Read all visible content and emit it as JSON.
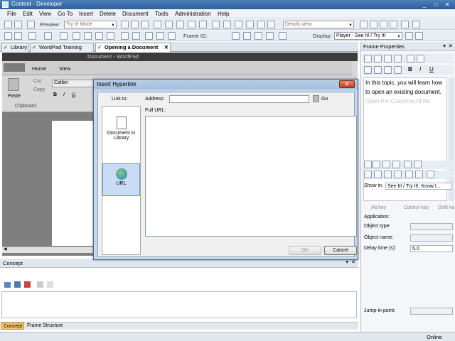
{
  "window": {
    "title": "Content - Developer",
    "min": "_",
    "max": "□",
    "close": "✕"
  },
  "menu": [
    "File",
    "Edit",
    "View",
    "Go To",
    "Insert",
    "Delete",
    "Document",
    "Tools",
    "Administration",
    "Help"
  ],
  "toolbar1": {
    "preview_label": "Preview",
    "mode_combo": "Try It! Mode",
    "view_combo": "Details view"
  },
  "toolbar2": {
    "frame_id_label": "Frame ID:",
    "display_label": "Display:",
    "display_combo": "Player - See It! / Try It!"
  },
  "doc_tabs": [
    "Library",
    "WordPad Training",
    "Opening a Document"
  ],
  "wordpad": {
    "title": "Document - WordPad",
    "tab_home": "Home",
    "tab_view": "View",
    "font": "Calibri",
    "paste": "Paste",
    "cut": "Cut",
    "copy": "Copy",
    "clipboard": "Clipboard"
  },
  "concept": {
    "header": "Concept",
    "tabs": [
      "Concept",
      "Frame Structure"
    ]
  },
  "frame_props": {
    "header": "Frame Properties",
    "bubble_text_1": "In this topic, you will learn how to open an existing document.",
    "bubble_text_2": "Open the Customer.rtf file.",
    "show_in_label": "Show in:",
    "show_in_value": "See It! / Try It!, Know I...",
    "alt_key": "Alt key",
    "control_key": "Control key",
    "shift_key": "Shift ke",
    "application": "Application:",
    "object_type": "Object type:",
    "object_name": "Object name:",
    "delay_label": "Delay time (s):",
    "delay_value": "5.0",
    "jump_in": "Jump-in point:"
  },
  "status": {
    "online": "Online"
  },
  "dialog": {
    "title": "Insert Hyperlink",
    "link_to": "Link to:",
    "address_label": "Address:",
    "address_value": "",
    "go": "Go",
    "full_url": "Full URL:",
    "option_doc": "Document in Library",
    "option_url": "URL",
    "ok": "OK",
    "cancel": "Cancel"
  },
  "colors": {
    "accent": "#2e5f97",
    "dialog_bg": "#c6d8ec",
    "selected_link": "#c9dcf3"
  }
}
